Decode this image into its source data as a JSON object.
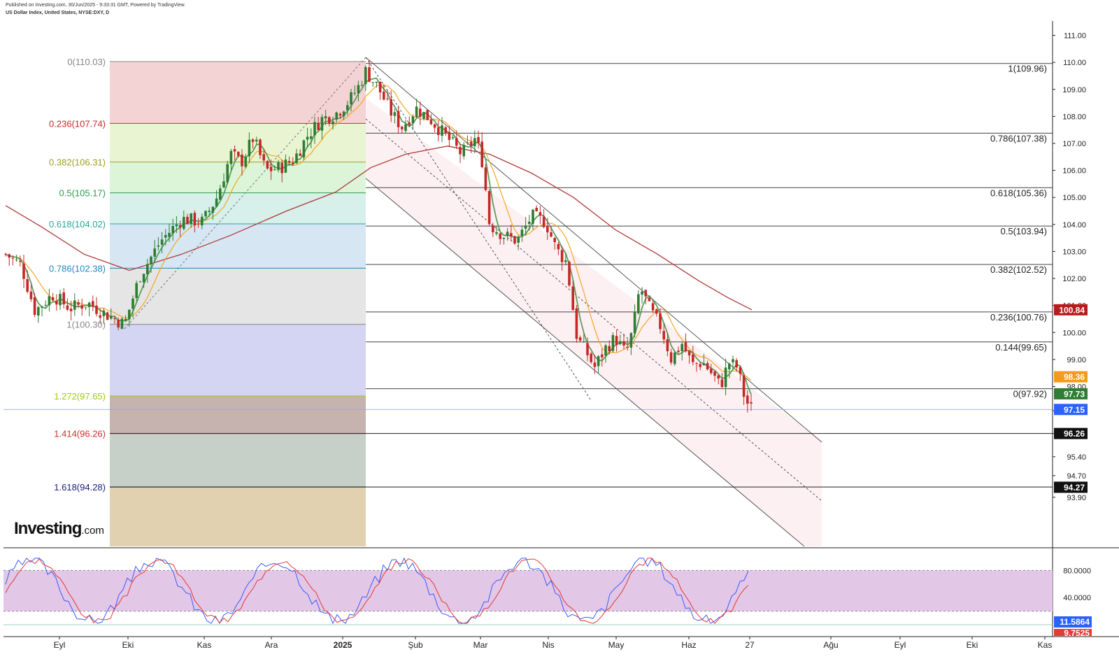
{
  "header": {
    "published": "Published on Investing.com, 30/Jun/2025 - 9:33:31 GMT, Powered by TradingView.",
    "symbol": "US Dollar Index, United States, NYSE:DXY, D"
  },
  "logo": {
    "brand": "Investing",
    "suffix": ".com"
  },
  "chart_data": {
    "type": "candlestick",
    "price_axis": {
      "ticks": [
        "111.00",
        "110.00",
        "109.00",
        "108.00",
        "107.00",
        "106.00",
        "105.00",
        "104.00",
        "103.00",
        "102.00",
        "101.00",
        "100.00",
        "99.00",
        "98.00",
        "97.10",
        "96.26",
        "95.40",
        "94.70",
        "93.90"
      ],
      "range": [
        93.3,
        111.6
      ]
    },
    "time_axis": {
      "labels": [
        "Eyl",
        "Eki",
        "Kas",
        "Ara",
        "2025",
        "Şub",
        "Mar",
        "Nis",
        "May",
        "Haz",
        "27",
        "Ağu",
        "Eyl",
        "Eki",
        "Kas"
      ]
    },
    "fib_retracement_left": {
      "levels": [
        {
          "label": "0(110.03)",
          "value": 110.03,
          "color": "#888888"
        },
        {
          "label": "0.236(107.74)",
          "value": 107.74,
          "color": "#c62828"
        },
        {
          "label": "0.382(106.31)",
          "value": 106.31,
          "color": "#9e9d24"
        },
        {
          "label": "0.5(105.17)",
          "value": 105.17,
          "color": "#2e9d48"
        },
        {
          "label": "0.618(104.02)",
          "value": 104.02,
          "color": "#26a69a"
        },
        {
          "label": "0.786(102.38)",
          "value": 102.38,
          "color": "#1e88c0"
        },
        {
          "label": "1(100.30)",
          "value": 100.3,
          "color": "#888888"
        },
        {
          "label": "1.272(97.65)",
          "value": 97.65,
          "color": "#9ccc0a"
        },
        {
          "label": "1.414(96.26)",
          "value": 96.26,
          "color": "#d32f2f"
        },
        {
          "label": "1.618(94.28)",
          "value": 94.28,
          "color": "#1a237e"
        }
      ],
      "zone_colors": [
        "#f3d3d3",
        "#e9f5d2",
        "#dcf5d9",
        "#d7f0ea",
        "#d6e7f3",
        "#e5e5e5",
        "#d3d5f3",
        "#c6b2ae",
        "#c6d0c9",
        "#e2d1b0"
      ]
    },
    "fib_retracement_right": {
      "levels": [
        {
          "label": "1(109.96)",
          "value": 109.96
        },
        {
          "label": "0.786(107.38)",
          "value": 107.38
        },
        {
          "label": "0.618(105.36)",
          "value": 105.36
        },
        {
          "label": "0.5(103.94)",
          "value": 103.94
        },
        {
          "label": "0.382(102.52)",
          "value": 102.52
        },
        {
          "label": "0.236(100.76)",
          "value": 100.76
        },
        {
          "label": "0.144(99.65)",
          "value": 99.65
        },
        {
          "label": "0(97.92)",
          "value": 97.92
        }
      ]
    },
    "price_badges": [
      {
        "text": "100.84",
        "value": 100.84,
        "color": "#b71c1c"
      },
      {
        "text": "98.36",
        "value": 98.36,
        "color": "#f59a1c"
      },
      {
        "text": "97.73",
        "value": 97.73,
        "color": "#2e7d32"
      },
      {
        "text": "97.15",
        "value": 97.15,
        "color": "#2962ff"
      },
      {
        "text": "96.26",
        "value": 96.26,
        "color": "#111111"
      },
      {
        "text": "94.27",
        "value": 94.27,
        "color": "#111111"
      }
    ],
    "oscillator": {
      "ticks": [
        "80.0000",
        "40.0000"
      ],
      "range": [
        0,
        100
      ],
      "band": [
        20,
        80
      ],
      "badges": [
        {
          "text": "11.5864",
          "color": "#2962ff"
        },
        {
          "text": "9.7525",
          "color": "#e53935"
        }
      ]
    },
    "moving_averages": [
      {
        "color": "#b03a3a",
        "role": "long"
      },
      {
        "color": "#f5a623",
        "role": "medium"
      },
      {
        "color": "#5e9c5e",
        "role": "short"
      }
    ],
    "colors": {
      "up": "#2e7d32",
      "down": "#c62828"
    }
  }
}
